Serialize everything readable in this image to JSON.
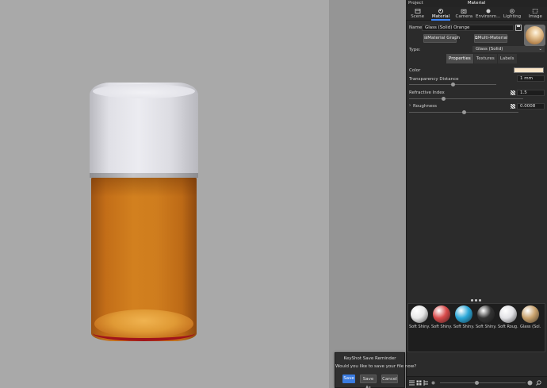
{
  "panel": {
    "project_label": "Project",
    "title": "Material",
    "tabs": [
      {
        "label": "Scene",
        "icon": "scene-icon"
      },
      {
        "label": "Material",
        "icon": "material-icon",
        "active": true
      },
      {
        "label": "Camera",
        "icon": "camera-icon"
      },
      {
        "label": "Environm...",
        "icon": "environment-icon"
      },
      {
        "label": "Lighting",
        "icon": "lighting-icon"
      },
      {
        "label": "Image",
        "icon": "image-icon"
      }
    ],
    "accent_color": "#3d86ff"
  },
  "material": {
    "name_label": "Name:",
    "name_value": "Glass (Solid) Orange",
    "material_graph_button": "Material Graph",
    "multi_material_button": "Multi-Material",
    "type_label": "Type:",
    "type_value": "Glass (Solid)",
    "subtabs": [
      "Properties",
      "Textures",
      "Labels"
    ],
    "color_label": "Color",
    "color_value": "#fbe6c9",
    "transparency_label": "Transparency Distance",
    "transparency_value": "1 mm",
    "transparency_level": 0.5,
    "refractive_label": "Refractive Index",
    "refractive_value": "1.5",
    "refractive_level": 0.3,
    "roughness_label": "Roughness",
    "roughness_value": "0.0008",
    "roughness_level": 0.5
  },
  "library": {
    "swatches": [
      {
        "name": "Soft Shiny...",
        "color": "#e8e8e8"
      },
      {
        "name": "Soft Shiny...",
        "color": "#d84a4a"
      },
      {
        "name": "Soft Shiny...",
        "color": "#2aa7d8"
      },
      {
        "name": "Soft Shiny...",
        "color": "#333333"
      },
      {
        "name": "Soft Roug...",
        "color": "#e2e2e6"
      },
      {
        "name": "Glass (Sol...",
        "color": "#c9a26d"
      }
    ]
  },
  "dialog": {
    "title": "KeyShot Save Reminder",
    "message": "Would you like to save your file now?",
    "save_button": "Save",
    "save_as_button": "Save As",
    "cancel_button": "Cancel"
  }
}
